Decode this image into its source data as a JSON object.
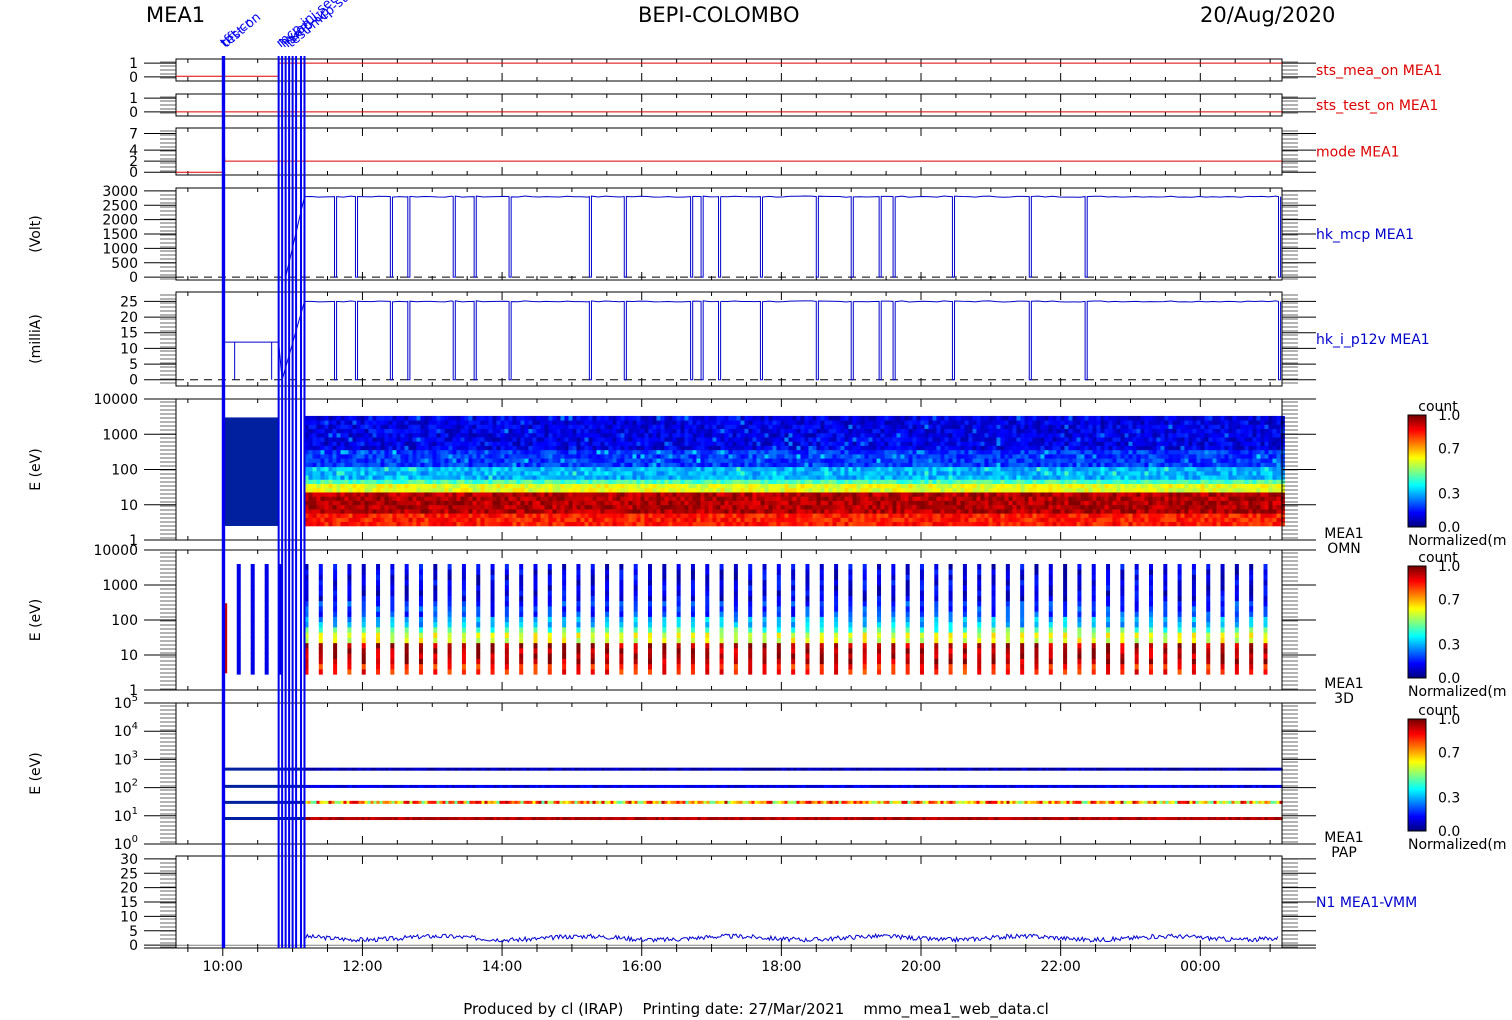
{
  "header": {
    "left": "MEA1",
    "center": "BEPI-COLOMBO",
    "right": "20/Aug/2020"
  },
  "footer": "Produced by cl (IRAP)    Printing date: 27/Mar/2021    mmo_mea1_web_data.cl",
  "colors": {
    "red_trace": "#dd0000",
    "blue_trace": "#0000cc",
    "event_marker": "#0000ee"
  },
  "chart_data": {
    "type": "multi-panel time series",
    "x_axis": {
      "ticks": [
        "10:00",
        "12:00",
        "14:00",
        "16:00",
        "18:00",
        "20:00",
        "22:00",
        "00:00"
      ],
      "range_hours": [
        9.33,
        25.17
      ]
    },
    "event_labels": [
      "tfft-cr",
      "test-on",
      "mcp-inj-set",
      "hv-on",
      "ramp-up",
      "test-mcp-step"
    ],
    "panels": [
      {
        "id": "sts_mea_on",
        "label": "sts_mea_on MEA1",
        "color": "red",
        "type": "line",
        "yticks": [
          "0",
          "1"
        ],
        "ylim": [
          -0.3,
          1.3
        ],
        "series": [
          [
            9.33,
            0.05
          ],
          [
            10.0,
            0.05
          ],
          [
            10.0,
            0.05
          ],
          [
            10.8,
            0.05
          ],
          [
            10.8,
            1.0
          ],
          [
            25.17,
            1.0
          ]
        ]
      },
      {
        "id": "sts_test_on",
        "label": "sts_test_on MEA1",
        "color": "red",
        "type": "line",
        "yticks": [
          "0",
          "1"
        ],
        "ylim": [
          -0.3,
          1.3
        ],
        "series": [
          [
            9.33,
            0.0
          ],
          [
            25.17,
            0.0
          ]
        ]
      },
      {
        "id": "mode",
        "label": "mode MEA1",
        "color": "red",
        "type": "line",
        "yticks": [
          "0",
          "2",
          "4",
          "7"
        ],
        "ylim": [
          -0.5,
          8
        ],
        "series": [
          [
            9.33,
            0
          ],
          [
            10.0,
            0
          ],
          [
            10.0,
            7
          ],
          [
            10.03,
            2
          ],
          [
            25.17,
            2
          ]
        ]
      },
      {
        "id": "hk_mcp",
        "label": "hk_mcp MEA1",
        "unit": "(Volt)",
        "color": "blue",
        "type": "line",
        "yticks": [
          "0",
          "500",
          "1000",
          "1500",
          "2000",
          "2500",
          "3000"
        ],
        "ylim": [
          -100,
          3100
        ],
        "level": 2800,
        "start": 11.17,
        "ramp_start": 10.9,
        "dips": [
          11.6,
          11.9,
          12.4,
          12.65,
          13.3,
          13.6,
          14.1,
          15.25,
          15.75,
          16.7,
          16.85,
          17.1,
          17.7,
          18.5,
          19.0,
          19.4,
          19.6,
          20.45,
          21.55,
          22.35,
          25.12
        ]
      },
      {
        "id": "hk_i_p12v",
        "label": "hk_i_p12v MEA1",
        "unit": "(milliA)",
        "color": "blue",
        "type": "line",
        "yticks": [
          "0",
          "5",
          "10",
          "15",
          "20",
          "25"
        ],
        "ylim": [
          -2,
          28
        ],
        "level": 25,
        "pre_level": 12,
        "start": 11.17,
        "dips": [
          10.17,
          10.7,
          11.6,
          11.9,
          12.4,
          12.65,
          13.3,
          13.6,
          14.1,
          15.25,
          15.75,
          16.7,
          16.85,
          17.1,
          17.7,
          18.5,
          19.0,
          19.4,
          19.6,
          20.45,
          21.55,
          22.35,
          25.12
        ]
      },
      {
        "id": "omn",
        "label1": "MEA1",
        "label2": "OMN",
        "unit": "E (eV)",
        "type": "spectrogram",
        "yticks": [
          "1",
          "10",
          "100",
          "1000",
          "10000"
        ],
        "ylog": [
          0,
          4
        ],
        "colorbar": {
          "title": "count",
          "ticks": [
            "0.0",
            "0.3",
            "0.7",
            "1.0"
          ],
          "footer": "Normalized(m"
        }
      },
      {
        "id": "3d",
        "label1": "MEA1",
        "label2": "3D",
        "unit": "E (eV)",
        "type": "spectrogram-bars",
        "yticks": [
          "1",
          "10",
          "100",
          "1000",
          "10000"
        ],
        "ylog": [
          0,
          4
        ],
        "colorbar": {
          "title": "count",
          "ticks": [
            "0.0",
            "0.3",
            "0.7",
            "1.0"
          ],
          "footer": "Normalized(m"
        }
      },
      {
        "id": "pap",
        "label1": "MEA1",
        "label2": "PAP",
        "unit": "E (eV)",
        "type": "spectrogram-lines",
        "yticks": [
          "10^0",
          "10^1",
          "10^2",
          "10^3",
          "10^4",
          "10^5"
        ],
        "ylog": [
          0,
          5
        ],
        "levels_eV": [
          8,
          30,
          110,
          450
        ],
        "colorbar": {
          "title": "count",
          "ticks": [
            "0.0",
            "0.3",
            "0.7",
            "1.0"
          ],
          "footer": "Normalized(m"
        }
      },
      {
        "id": "n1",
        "label": "N1 MEA1-VMM",
        "color": "blue",
        "type": "line",
        "yticks": [
          "0",
          "5",
          "10",
          "15",
          "20",
          "25",
          "30"
        ],
        "ylim": [
          -1,
          31
        ],
        "level": 2.5,
        "start": 11.17
      }
    ],
    "event_times_hours": [
      10.0,
      10.02,
      10.8,
      10.85,
      10.9,
      10.95,
      11.0,
      11.05,
      11.12,
      11.17
    ]
  }
}
